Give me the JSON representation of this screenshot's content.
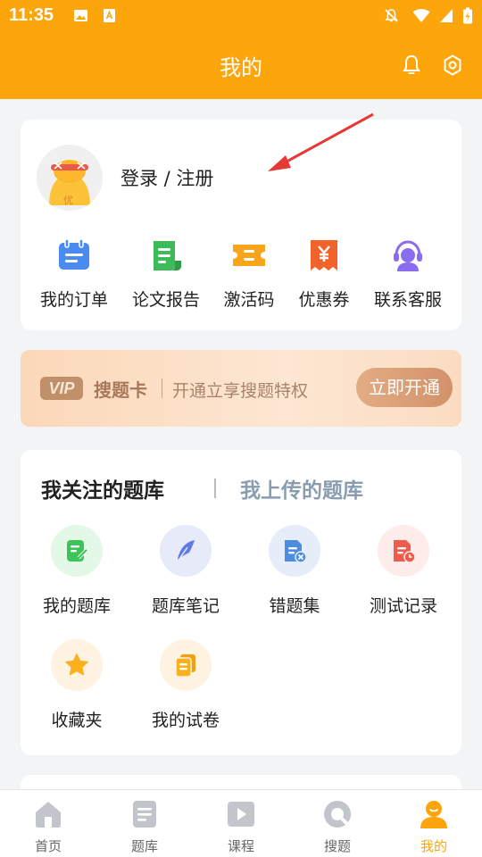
{
  "status": {
    "time": "11:35"
  },
  "header": {
    "title": "我的"
  },
  "profile": {
    "login_label": "登录 / 注册",
    "avatar_badge": "优",
    "quick_items": [
      {
        "label": "我的订单",
        "icon": "order-icon",
        "color": "#4a8bf0"
      },
      {
        "label": "论文报告",
        "icon": "report-icon",
        "color": "#3dbb5a"
      },
      {
        "label": "激活码",
        "icon": "code-icon",
        "color": "#f9a51b"
      },
      {
        "label": "优惠券",
        "icon": "coupon-icon",
        "color": "#f2632c"
      },
      {
        "label": "联系客服",
        "icon": "service-icon",
        "color": "#8a6cf0"
      }
    ]
  },
  "vip": {
    "badge": "VIP",
    "name": "搜题卡",
    "desc": "开通立享搜题特权",
    "button": "立即开通"
  },
  "library": {
    "tab_active": "我关注的题库",
    "tab_inactive": "我上传的题库",
    "items": [
      {
        "label": "我的题库",
        "icon": "my-bank-icon",
        "bg": "#e4f8e7",
        "color": "#3ec35a"
      },
      {
        "label": "题库笔记",
        "icon": "note-feather-icon",
        "bg": "#e7ebf9",
        "color": "#5f7ae8"
      },
      {
        "label": "错题集",
        "icon": "wrong-questions-icon",
        "bg": "#e5edf9",
        "color": "#4c8de0"
      },
      {
        "label": "测试记录",
        "icon": "test-record-icon",
        "bg": "#fdecea",
        "color": "#ef5b4c"
      },
      {
        "label": "收藏夹",
        "icon": "favorites-star-icon",
        "bg": "#fdf3e0",
        "color": "#fbb020"
      },
      {
        "label": "我的试卷",
        "icon": "my-papers-icon",
        "bg": "#fdf3e0",
        "color": "#fbb020"
      }
    ]
  },
  "nav": {
    "items": [
      {
        "label": "首页",
        "icon": "home-icon",
        "active": false
      },
      {
        "label": "题库",
        "icon": "question-bank-icon",
        "active": false
      },
      {
        "label": "课程",
        "icon": "course-play-icon",
        "active": false
      },
      {
        "label": "搜题",
        "icon": "search-question-icon",
        "active": false
      },
      {
        "label": "我的",
        "icon": "profile-icon",
        "active": true
      }
    ],
    "active_color": "#fda60c",
    "inactive_color": "#c2c6cc"
  }
}
